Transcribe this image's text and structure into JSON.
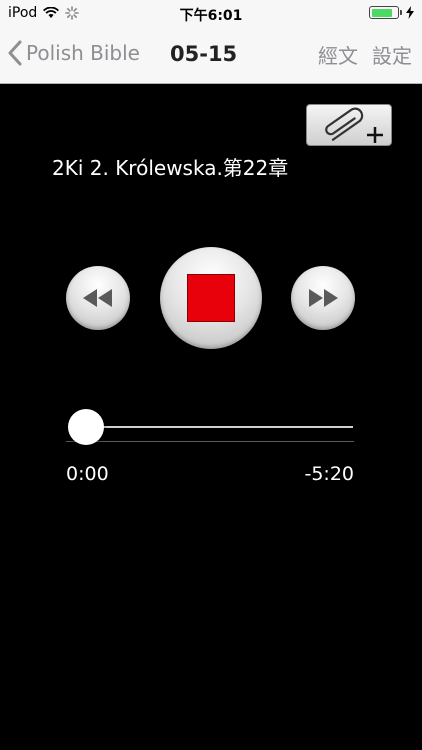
{
  "status_bar": {
    "carrier": "iPod",
    "time": "下午6:01",
    "battery_level": 0.85
  },
  "nav": {
    "back_label": "Polish Bible",
    "title": "05-15",
    "scripture_label": "經文",
    "settings_label": "設定"
  },
  "player": {
    "chapter_title": "2Ki 2. Królewska.第22章",
    "elapsed": "0:00",
    "remaining": "-5:20",
    "progress": 0.0,
    "stop_color": "#e8000b"
  },
  "icons": {
    "attach": "paperclip-plus-icon",
    "rewind": "rewind-icon",
    "stop": "stop-icon",
    "forward": "fast-forward-icon"
  }
}
